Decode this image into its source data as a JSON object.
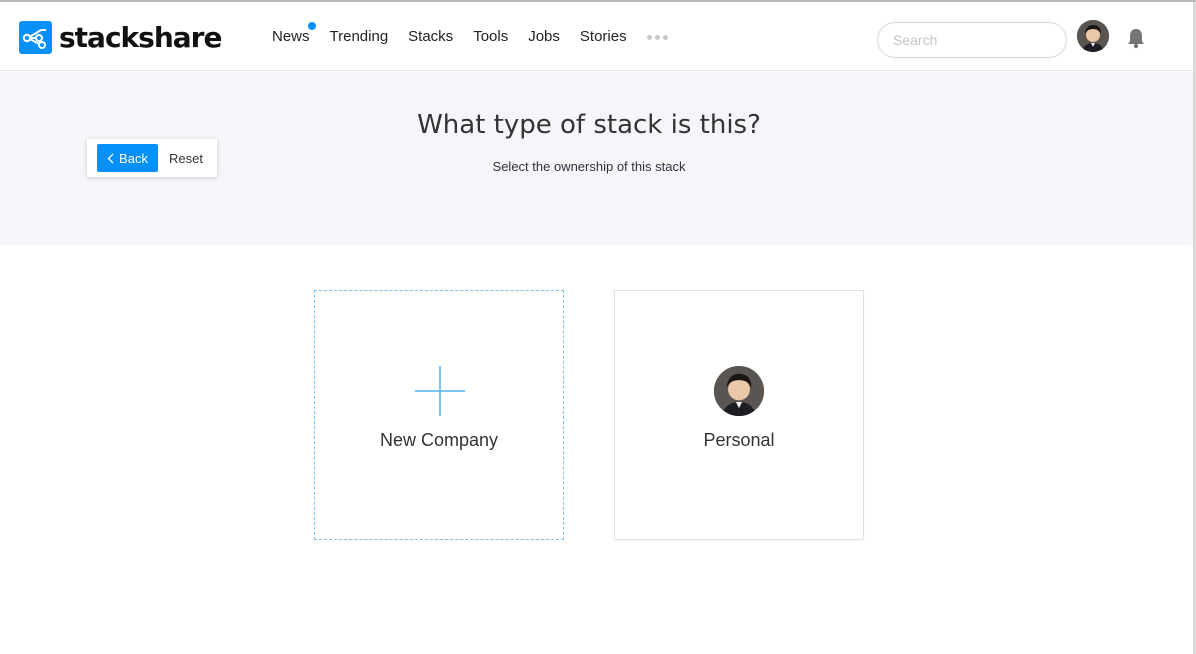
{
  "header": {
    "brand": "stackshare",
    "nav": [
      {
        "label": "News",
        "has_dot": true
      },
      {
        "label": "Trending"
      },
      {
        "label": "Stacks"
      },
      {
        "label": "Tools"
      },
      {
        "label": "Jobs"
      },
      {
        "label": "Stories"
      }
    ],
    "more_icon": "ellipsis-icon",
    "search": {
      "placeholder": "Search",
      "value": ""
    },
    "notifications_icon": "bell-icon"
  },
  "hero": {
    "title": "What type of stack is this?",
    "subtitle": "Select the ownership of this stack"
  },
  "actions": {
    "back_label": "Back",
    "reset_label": "Reset"
  },
  "options": [
    {
      "label": "New Company",
      "icon": "plus-icon"
    },
    {
      "label": "Personal",
      "icon": "avatar"
    }
  ],
  "colors": {
    "accent": "#0690fa",
    "hero_bg": "#f4f6f9",
    "dashed_border": "#7cc0f0"
  }
}
